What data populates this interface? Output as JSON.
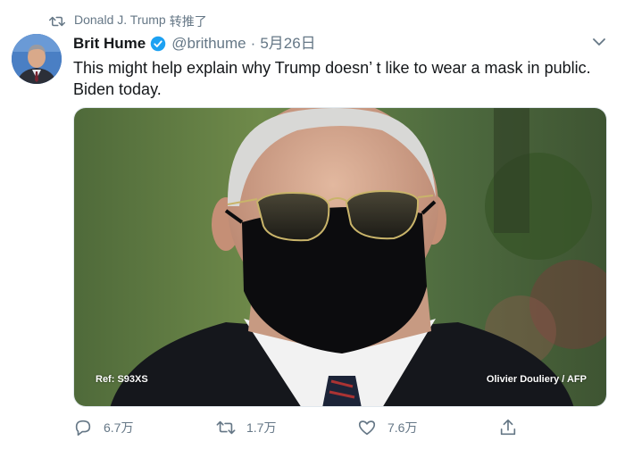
{
  "retweet_context": {
    "icon": "retweet-icon",
    "user": "Donald J. Trump",
    "action": "转推了"
  },
  "author": {
    "display_name": "Brit Hume",
    "verified": true,
    "handle": "@brithume",
    "separator": "·",
    "date": "5月26日"
  },
  "tweet": {
    "text": "This might help explain why Trump doesn’ t like to wear a mask in public. Biden today."
  },
  "media": {
    "caption_left": "Ref: S93XS",
    "caption_right": "Olivier Douliery / AFP"
  },
  "actions": {
    "reply_count": "6.7万",
    "retweet_count": "1.7万",
    "like_count": "7.6万"
  },
  "colors": {
    "text_primary": "#14171a",
    "text_secondary": "#657786",
    "verified_blue": "#1da1f2"
  },
  "icons": [
    "retweet-icon",
    "verified-icon",
    "chevron-down-icon",
    "reply-icon",
    "like-icon",
    "share-icon"
  ]
}
